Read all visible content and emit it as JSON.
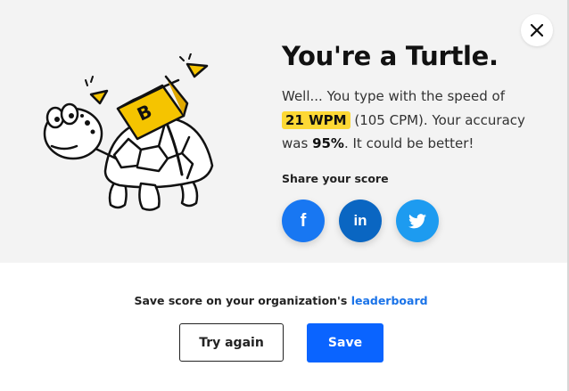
{
  "result": {
    "title": "You're a Turtle.",
    "line_prefix": "Well... You type with the speed of",
    "wpm": "21 WPM",
    "cpm": "(105 CPM). Your accuracy",
    "was": "was",
    "accuracy": "95%",
    "suffix": ". It could be better!"
  },
  "share": {
    "label": "Share your score",
    "buttons": [
      {
        "name": "facebook",
        "glyph": "f",
        "color": "#1877f2"
      },
      {
        "name": "linkedin",
        "glyph": "in",
        "color": "#0a66c2"
      },
      {
        "name": "twitter",
        "glyph": "twitter-bird",
        "color": "#1d9bf0"
      }
    ]
  },
  "leaderboard": {
    "prefix": "Save score on your organization's",
    "link": "leaderboard"
  },
  "actions": {
    "try_again": "Try again",
    "save": "Save"
  },
  "icons": {
    "close": "close-icon",
    "illustration": "turtle-illustration"
  },
  "colors": {
    "highlight": "#fdd835",
    "primary": "#0a64ff",
    "link": "#1a73e8",
    "panel": "#f3f3f3"
  }
}
